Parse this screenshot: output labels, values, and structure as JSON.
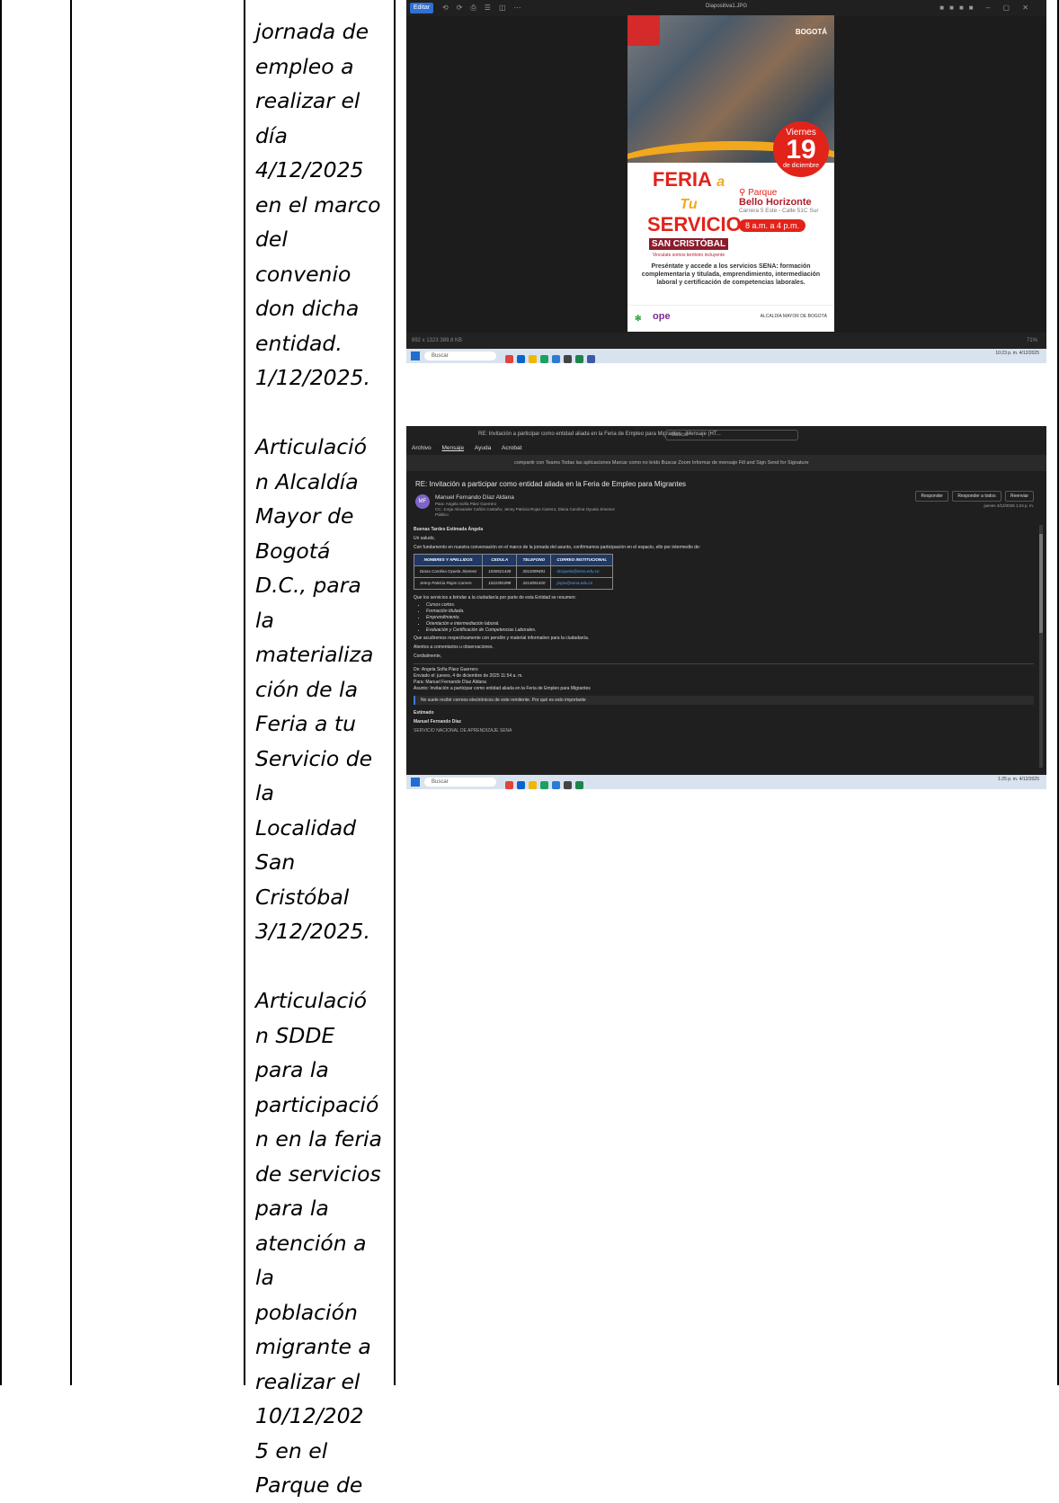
{
  "cell_text": {
    "paragraphs": [
      [
        "jornada de",
        "empleo a",
        "realizar el",
        "día",
        "4/12/2025",
        "en el marco",
        "del",
        "convenio",
        "don dicha",
        "entidad.",
        "1/12/2025."
      ],
      [
        "Articulació",
        "n Alcaldía",
        "Mayor de",
        "Bogotá",
        "D.C., para",
        "la",
        "materializa",
        "ción de la",
        "Feria a tu",
        "Servicio de",
        "la",
        "Localidad",
        "San",
        "Cristóbal",
        "3/12/2025."
      ],
      [
        "Articulació",
        "n SDDE",
        "para la",
        "participació",
        "n en la feria",
        "de servicios",
        "para la",
        "atención a",
        "la",
        "población",
        "migrante a",
        "realizar el",
        "10/12/202",
        "5 en el",
        "Parque de"
      ]
    ]
  },
  "shot1": {
    "window_title": "Diapositiva1.JPG",
    "edit_label": "Editar",
    "poster": {
      "brand": "BOGOTÁ",
      "weekday": "Viernes",
      "day": "19",
      "month": "de diciembre",
      "feria_1": "FERIA",
      "feria_atu": "a Tu",
      "feria_2": "SERVICIO",
      "locality": "SAN CRISTÓBAL",
      "locality_sub": "Vinculate somos territorio incluyente",
      "place_1": "Parque",
      "place_2": "Bello Horizonte",
      "address": "Carrera 5 Este - Calle 51C Sur",
      "hours": "8 a.m. a 4 p.m.",
      "body": "Preséntate y accede a los servicios SENA: formación complementaria y titulada, emprendimiento, intermediación laboral y certificación de competencias laborales.",
      "logo_left": "✻",
      "logo_mid": "ope",
      "footer_right": "ALCALDÍA MAYOR DE BOGOTÁ"
    },
    "status_left": "892 x 1323   389.8 KB",
    "status_right": "71%",
    "taskbar_search": "Buscar",
    "clock": "10:23 p. m. 4/12/2025"
  },
  "shot2": {
    "window_title": "RE: Invitación a participar como entidad aliada en la Feria de Empleo para Migrantes - Mensaje (HT...",
    "search_placeholder": "Buscar",
    "menu": [
      "Archivo",
      "Mensaje",
      "Ayuda",
      "Acrobat"
    ],
    "ribbon": "compartir con Teams   Todas las aplicaciones   Marcar como no leído   Buscar   Zoom   Informar de mensaje   Fill and Sign   Send for Signature",
    "subject": "RE: Invitación a participar como entidad aliada en la Feria de Empleo para Migrantes",
    "avatar": "MF",
    "sender": "Manuel Fernando Díaz Aldana",
    "to_line": "Para: Angela Sofía Páez Guerrero",
    "cc_line": "CC: Jorge Alexander Cañón Castaño; Jenny Patricia Rojas Carrero; Diana Carolina Oyuela Jimenez",
    "public_label": "Público",
    "actions": [
      "Responder",
      "Responder a todos",
      "Reenviar"
    ],
    "date": "jueves 4/12/2025 1:24 p. m.",
    "greeting": "Buenas Tardes Estimada Ángela",
    "saludo": "Un saludo,",
    "intro": "Con fundamento en nuestra conversación en el marco de la jornada del asunto, confirmamos participación en el espacio, ello por intermedio de:",
    "table_headers": [
      "NOMBRES Y APELLIDOS",
      "CEDULA",
      "TELEFONO",
      "CORREO INSTITUCIONAL"
    ],
    "table_rows": [
      [
        "Diana Carolina Oyuela Jimenez",
        "1030521448",
        "3012099491",
        "dcoyuela@sena.edu.co"
      ],
      [
        "Jenny Patricia Rojas Carrero",
        "1022391098",
        "3213091420",
        "jrojas@sena.edu.co"
      ]
    ],
    "services_intro": "Que los servicios a brindar a la ciudadanía por parte de esta Entidad se resumen:",
    "services": [
      "Cursos cortos.",
      "Formación titulada.",
      "Emprendimiento.",
      "Orientación e intermediación laboral.",
      "Evaluación y Certificación de Competencias Laborales."
    ],
    "closing_1": "Que acudiremos respectivamente con pendón y material informativo para la ciudadanía.",
    "closing_2": "Atentos a comentarios u observaciones.",
    "closing_3": "Cordialmente,",
    "fwd_from": "De: Angela Sofía Páez Guerrero",
    "fwd_sent": "Enviado el: jueves, 4 de diciembre de 2025 11:54 a. m.",
    "fwd_to": "Para: Manuel Fernando Díaz Aldana",
    "fwd_subject": "Asunto: Invitación a participar como entidad aliada en la Feria de Empleo para Migrantes",
    "fwd_notice": "No suele recibir correos electrónicos de este remitente. Por qué es esto importante",
    "estimado": "Estimado",
    "name_bold": "Manuel Fernando Díaz",
    "org": "SERVICIO NACIONAL DE APRENDIZAJE SENA",
    "taskbar_search": "Buscar",
    "clock": "1:25 p. m. 4/12/2025"
  },
  "colors": {
    "accent_red": "#e2231a",
    "accent_yellow": "#f2a81d",
    "accent_blue": "#1f6fd1"
  }
}
